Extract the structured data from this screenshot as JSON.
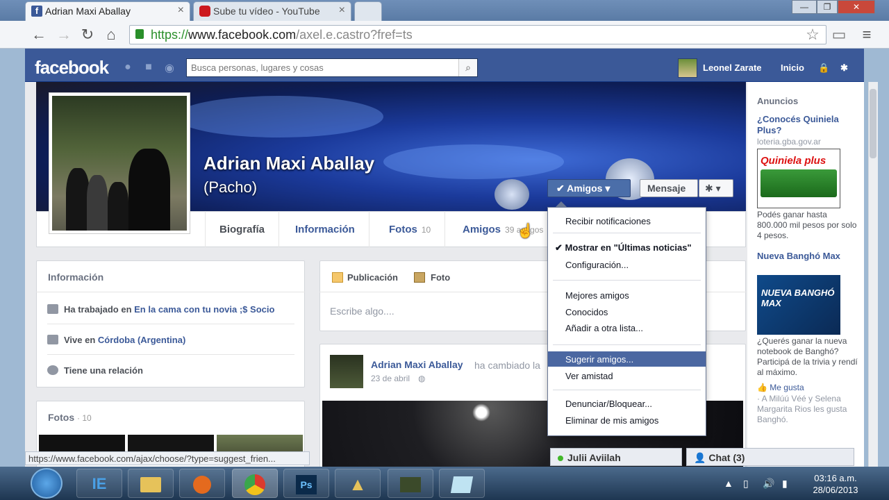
{
  "browser": {
    "tabs": [
      {
        "title": "Adrian Maxi Aballay",
        "favicon_color": "#3b5998"
      },
      {
        "title": "Sube tu vídeo - YouTube",
        "favicon_color": "#cc181e"
      }
    ],
    "close_glyph": "×",
    "url_scheme": "https://",
    "url_domain": "www.facebook.com",
    "url_path": "/axel.e.castro?fref=ts",
    "window_controls": [
      "—",
      "❐",
      "✕"
    ]
  },
  "fb": {
    "logo": "facebook",
    "search_placeholder": "Busca personas, lugares y cosas",
    "user_name": "Leonel Zarate",
    "home_link": "Inicio"
  },
  "profile": {
    "name": "Adrian Maxi Aballay",
    "nickname": "(Pacho)",
    "btn_amigos": "✔ Amigos ▾",
    "btn_mensaje": "Mensaje",
    "btn_gear": "✱ ▾",
    "tabs": [
      {
        "label": "Biografía",
        "count": ""
      },
      {
        "label": "Información",
        "count": ""
      },
      {
        "label": "Fotos",
        "count": "10"
      },
      {
        "label": "Amigos",
        "count": "39 amigos"
      }
    ]
  },
  "info_card": {
    "title": "Información",
    "rows": [
      {
        "prefix": "Ha trabajado en ",
        "link": "En la cama con tu novia ;$ Socio"
      },
      {
        "prefix": "Vive en ",
        "link": "Córdoba (Argentina)"
      },
      {
        "prefix": "Tiene una relación",
        "link": ""
      }
    ]
  },
  "fotos_card": {
    "title": "Fotos",
    "count": "· 10"
  },
  "composer": {
    "publicacion": "Publicación",
    "foto": "Foto",
    "placeholder": "Escribe algo...."
  },
  "post": {
    "author": "Adrian Maxi Aballay",
    "action": "ha cambiado la",
    "date": "23 de abril"
  },
  "dropdown": {
    "items": [
      {
        "label": "Recibir notificaciones",
        "style": ""
      },
      {
        "label": "✔ Mostrar en \"Últimas noticias\"",
        "style": "bold"
      },
      {
        "label": "Configuración...",
        "style": ""
      },
      {
        "label": "Mejores amigos",
        "style": ""
      },
      {
        "label": "Conocidos",
        "style": ""
      },
      {
        "label": "Añadir a otra lista...",
        "style": ""
      },
      {
        "label": "Sugerir amigos...",
        "style": "highlight"
      },
      {
        "label": "Ver amistad",
        "style": ""
      },
      {
        "label": "Denunciar/Bloquear...",
        "style": ""
      },
      {
        "label": "Eliminar de mis amigos",
        "style": ""
      }
    ]
  },
  "ads": {
    "title": "Anuncios",
    "ad1": {
      "headline": "¿Conocés Quiniela Plus?",
      "domain": "loteria.gba.gov.ar",
      "image_text": "Quiniela plus",
      "body": "Podés ganar hasta 800.000 mil pesos por solo 4 pesos."
    },
    "ad2": {
      "headline": "Nueva Banghó Max",
      "image_text": "NUEVA BANGHÓ MAX",
      "body": "¿Querés ganar la nueva notebook de Banghó? Participá de la trivia y rendí al máximo.",
      "like": "Me gusta",
      "social": "· A Milúú Véé y Selena Margarita Rios les gusta Banghó."
    }
  },
  "chat": {
    "contact": "Julii Aviilah",
    "chat_label": "Chat (3)"
  },
  "status_url": "https://www.facebook.com/ajax/choose/?type=suggest_frien...",
  "taskbar": {
    "time": "03:16 a.m.",
    "date": "28/06/2013",
    "apps": [
      "IE",
      "Explorer",
      "Media",
      "Chrome",
      "Ps",
      "App",
      "Camtasia",
      "Notes"
    ]
  }
}
